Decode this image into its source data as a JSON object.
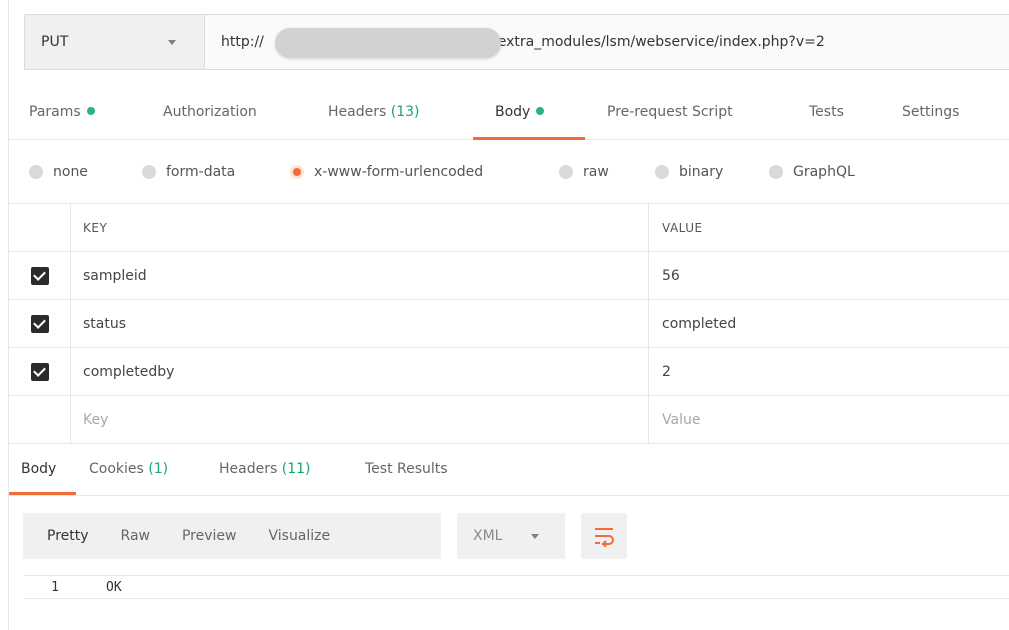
{
  "request": {
    "method": "PUT",
    "url_prefix": "http://",
    "url_suffix": "/extra_modules/lsm/webservice/index.php?v=2"
  },
  "request_tabs": [
    {
      "label": "Params",
      "dot": true
    },
    {
      "label": "Authorization"
    },
    {
      "label": "Headers",
      "count": "(13)"
    },
    {
      "label": "Body",
      "dot": true,
      "active": true
    },
    {
      "label": "Pre-request Script"
    },
    {
      "label": "Tests"
    },
    {
      "label": "Settings"
    }
  ],
  "body_types": [
    {
      "label": "none"
    },
    {
      "label": "form-data"
    },
    {
      "label": "x-www-form-urlencoded",
      "selected": true
    },
    {
      "label": "raw"
    },
    {
      "label": "binary"
    },
    {
      "label": "GraphQL"
    }
  ],
  "kv_table": {
    "headers": {
      "key": "KEY",
      "value": "VALUE"
    },
    "rows": [
      {
        "key": "sampleid",
        "value": "56",
        "checked": true
      },
      {
        "key": "status",
        "value": "completed",
        "checked": true
      },
      {
        "key": "completedby",
        "value": "2",
        "checked": true
      }
    ],
    "placeholder": {
      "key": "Key",
      "value": "Value"
    }
  },
  "response_tabs": [
    {
      "label": "Body",
      "active": true
    },
    {
      "label": "Cookies",
      "count": "(1)"
    },
    {
      "label": "Headers",
      "count": "(11)"
    },
    {
      "label": "Test Results"
    }
  ],
  "response_views": [
    "Pretty",
    "Raw",
    "Preview",
    "Visualize"
  ],
  "response_format": "XML",
  "response_lines": [
    {
      "no": "1",
      "text": "OK"
    }
  ],
  "colors": {
    "accent": "#f26b3a",
    "green": "#26b47f",
    "count_green": "#1aa56b"
  },
  "icons": {
    "method_dropdown": "chevron-down-icon",
    "format_dropdown": "chevron-down-icon",
    "wrap": "wrap-lines-icon",
    "check": "checkbox-checked-icon"
  }
}
